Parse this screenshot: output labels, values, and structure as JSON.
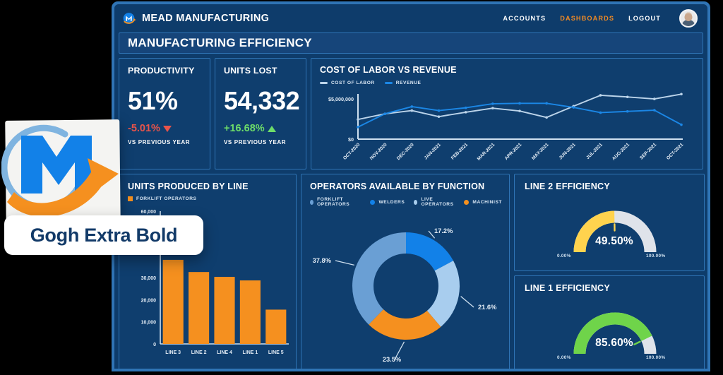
{
  "header": {
    "brand": "MEAD MANUFACTURING",
    "logo_icon": "mead-m-logo-icon",
    "nav": [
      {
        "label": "ACCOUNTS",
        "active": false
      },
      {
        "label": "DASHBOARDS",
        "active": true
      },
      {
        "label": "LOGOUT",
        "active": false
      }
    ],
    "avatar_icon": "user-avatar",
    "accent_color": "#f08a24"
  },
  "page": {
    "title": "MANUFACTURING EFFICIENCY"
  },
  "kpis": [
    {
      "title": "PRODUCTIVITY",
      "value": "51%",
      "delta": "-5.01%",
      "delta_direction": "down",
      "delta_icon": "triangle-down-icon",
      "delta_color": "#e8544a",
      "subtitle": "VS PREVIOUS YEAR"
    },
    {
      "title": "UNITS LOST",
      "value": "54,332",
      "delta": "+16.68%",
      "delta_direction": "up",
      "delta_icon": "triangle-up-icon",
      "delta_color": "#6ddc69",
      "subtitle": "VS PREVIOUS YEAR"
    }
  ],
  "overlay": {
    "logo_icon": "mead-m-logo-large-icon",
    "font_name": "Gogh Extra Bold"
  },
  "chart_data": [
    {
      "id": "cost-of-labor-vs-revenue",
      "type": "line",
      "title": "COST OF LABOR VS REVENUE",
      "xlabel": "",
      "ylabel": "",
      "ylim": [
        0,
        5800000
      ],
      "ytick_labels": [
        "$5,000,000",
        "$0"
      ],
      "yticks": [
        5000000,
        0
      ],
      "grid": false,
      "legend_position": "top-left",
      "x": [
        "OCT-2020",
        "NOV-2020",
        "DEC-2020",
        "JAN-2021",
        "FEB-2021",
        "MAR-2021",
        "APR-2021",
        "MAY-2021",
        "JUN-2021",
        "JUL-2021",
        "AUG-2021",
        "SEP-2021",
        "OCT-2021"
      ],
      "series": [
        {
          "name": "COST OF LABOR",
          "color": "#bcd4ea",
          "values": [
            2450000,
            3150000,
            3550000,
            2800000,
            3350000,
            3850000,
            3500000,
            2700000,
            4100000,
            5450000,
            5250000,
            5000000,
            5600000
          ]
        },
        {
          "name": "REVENUE",
          "color": "#1b87e6",
          "values": [
            1500000,
            3150000,
            4050000,
            3550000,
            3900000,
            4400000,
            4450000,
            4450000,
            3950000,
            3300000,
            3450000,
            3600000,
            1800000
          ]
        }
      ]
    },
    {
      "id": "units-produced-by-line",
      "type": "bar",
      "title": "UNITS PRODUCED BY LINE",
      "legend": [
        "FORKLIFT OPERATORS"
      ],
      "legend_color": "#f5901f",
      "xlabel": "",
      "ylabel": "",
      "ylim": [
        0,
        60000
      ],
      "ytick_labels": [
        "60,000",
        "30,000",
        "20,000",
        "10,000",
        "0"
      ],
      "yticks": [
        60000,
        30000,
        20000,
        10000,
        0
      ],
      "categories": [
        "LINE 3",
        "LINE 2",
        "LINE 4",
        "LINE 1",
        "LINE 5"
      ],
      "values": [
        38000,
        32500,
        30300,
        28700,
        15500
      ],
      "bar_color": "#f5901f"
    },
    {
      "id": "operators-available-by-function",
      "type": "pie",
      "subtype": "donut",
      "title": "OPERATORS AVAILABLE BY FUNCTION",
      "legend_position": "top",
      "labels": [
        "FORKLIFT OPERATORS",
        "WELDERS",
        "LIVE OPERATORS",
        "MACHINIST"
      ],
      "values": [
        37.8,
        17.2,
        21.6,
        23.5
      ],
      "value_labels": [
        "37.8%",
        "17.2%",
        "21.6%",
        "23.5%"
      ],
      "colors": [
        "#6a9fd4",
        "#1281e8",
        "#a8cdee",
        "#f5901f"
      ]
    },
    {
      "id": "line-2-efficiency",
      "type": "gauge",
      "title": "LINE 2 EFFICIENCY",
      "value": 49.5,
      "value_label": "49.50%",
      "min_label": "0.00%",
      "max_label": "100.00%",
      "min": 0,
      "max": 100,
      "fill_color": "#ffd34e",
      "track_color": "#dfe3ea"
    },
    {
      "id": "line-1-efficiency",
      "type": "gauge",
      "title": "LINE 1 EFFICIENCY",
      "value": 85.6,
      "value_label": "85.60%",
      "min_label": "0.00%",
      "max_label": "100.00%",
      "min": 0,
      "max": 100,
      "fill_color": "#6fd44a",
      "track_color": "#dfe3ea"
    }
  ]
}
